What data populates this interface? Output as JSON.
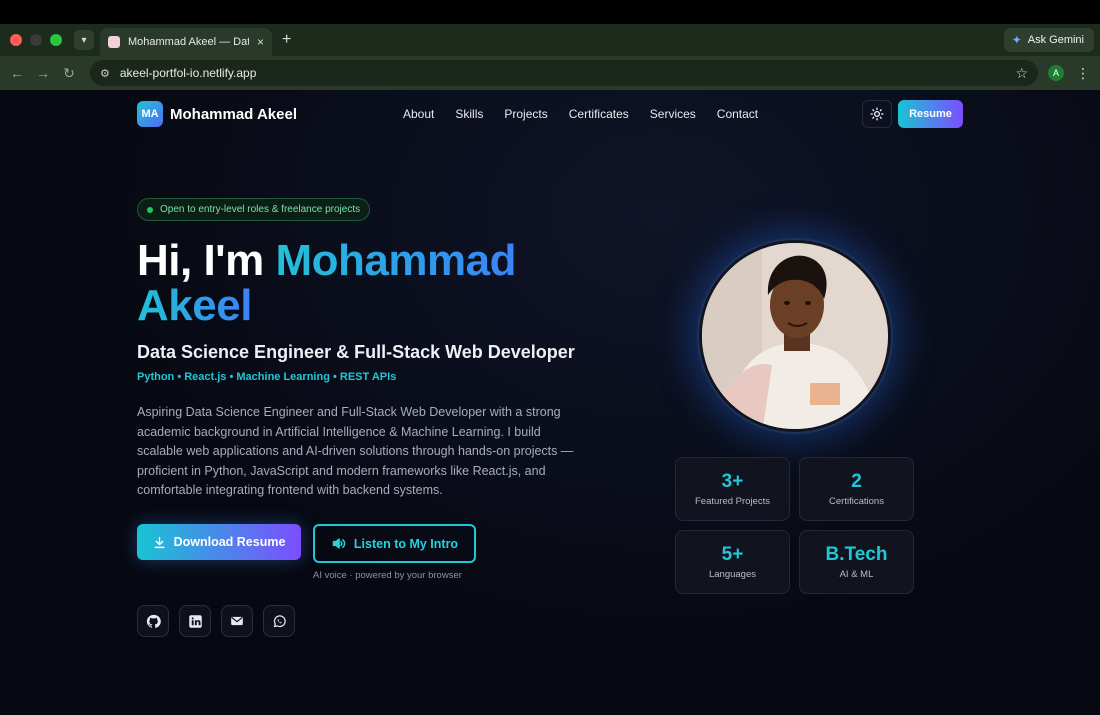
{
  "browser": {
    "tab_title": "Mohammad Akeel — Data Sci",
    "tab_close": "×",
    "new_tab": "+",
    "ask_gemini": "Ask Gemini",
    "url": "akeel-portfol-io.netlify.app",
    "profile_initial": "A"
  },
  "nav": {
    "logo_initials": "MA",
    "logo_name": "Mohammad Akeel",
    "links": [
      "About",
      "Skills",
      "Projects",
      "Certificates",
      "Services",
      "Contact"
    ],
    "resume_label": "Resume"
  },
  "hero": {
    "status_pill": "Open to entry-level roles & freelance projects",
    "greeting": "Hi, I'm ",
    "name_line1": "Mohammad",
    "name_line2": "Akeel",
    "subtitle": "Data Science Engineer & Full-Stack Web Developer",
    "stack": "Python • React.js • Machine Learning • REST APIs",
    "description": "Aspiring Data Science Engineer and Full-Stack Web Developer with a strong academic background in Artificial Intelligence & Machine Learning. I build scalable web applications and AI-driven solutions through hands-on projects — proficient in Python, JavaScript and modern frameworks like React.js, and comfortable integrating frontend with backend systems.",
    "download_label": "Download Resume",
    "listen_label": "Listen to My Intro",
    "voice_note": "AI voice · powered by your browser"
  },
  "stats": [
    {
      "value": "3+",
      "label": "Featured Projects"
    },
    {
      "value": "2",
      "label": "Certifications"
    },
    {
      "value": "5+",
      "label": "Languages"
    },
    {
      "value": "B.Tech",
      "label": "AI & ML"
    }
  ],
  "socials": [
    "github-icon",
    "linkedin-icon",
    "mail-icon",
    "whatsapp-icon"
  ],
  "colors": {
    "accent_cyan": "#22c7d6",
    "accent_blue": "#3b82f6",
    "accent_purple": "#7c4dff",
    "page_bg": "#070912"
  }
}
